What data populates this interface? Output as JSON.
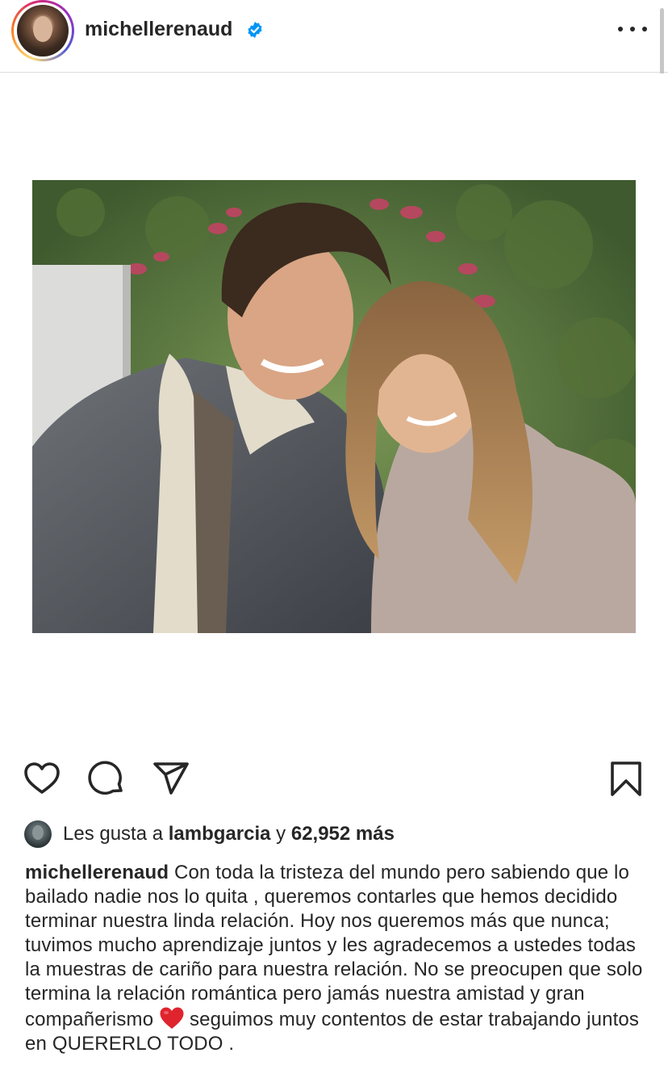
{
  "post": {
    "username": "michellerenaud",
    "verified": true,
    "verified_icon": "verified-badge-icon",
    "more_icon": "more-options-icon"
  },
  "actions": {
    "like_icon": "heart-icon",
    "comment_icon": "comment-icon",
    "share_icon": "send-icon",
    "save_icon": "bookmark-icon"
  },
  "likes": {
    "prefix": "Les gusta a",
    "user": "lambgarcia",
    "joiner": "y",
    "count": "62,952 más"
  },
  "caption": {
    "username": "michellerenaud",
    "text_part1": "Con toda la tristeza del mundo pero sabiendo que lo bailado nadie nos lo quita , queremos contarles que hemos decidido terminar nuestra linda relación. Hoy nos queremos más que nunca; tuvimos mucho aprendizaje juntos y les agradecemos a ustedes todas la muestras de cariño para nuestra relación. No se preocupen que solo termina la relación romántica pero jamás nuestra amistad y gran compañerismo",
    "emoji": "red-heart-emoji",
    "text_part2": "seguimos  muy contentos de estar trabajando juntos en QUERERLO TODO ."
  },
  "colors": {
    "text": "#262626",
    "verified_blue": "#0095f6",
    "heart_red": "#e0242e",
    "divider": "#dbdbdb"
  }
}
